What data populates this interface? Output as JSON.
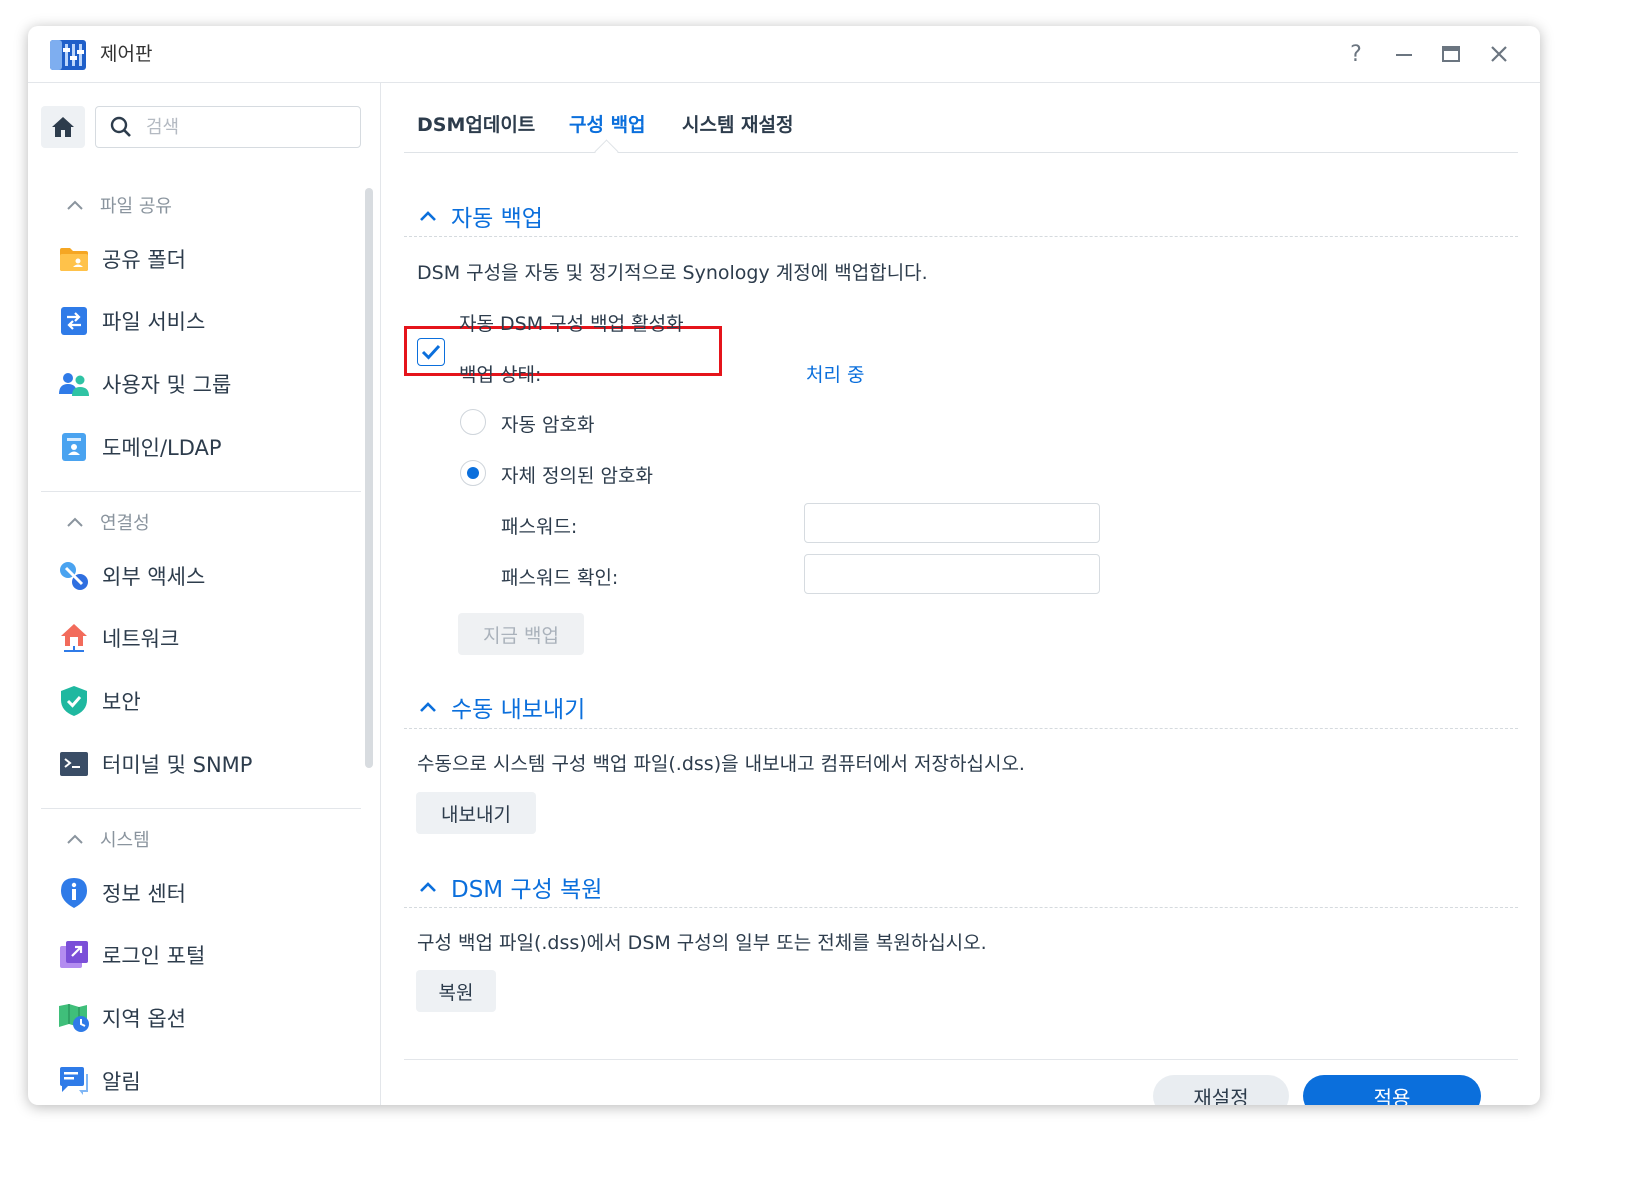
{
  "window": {
    "title": "제어판",
    "controls": {
      "help": "?",
      "minimize": "minimize",
      "maximize": "maximize",
      "close": "close"
    }
  },
  "sidebar": {
    "search": {
      "placeholder": "검색",
      "value": ""
    },
    "groups": [
      {
        "label": "파일 공유",
        "items": [
          {
            "label": "공유 폴더",
            "icon": "shared-folder-icon"
          },
          {
            "label": "파일 서비스",
            "icon": "file-services-icon"
          },
          {
            "label": "사용자 및 그룹",
            "icon": "users-groups-icon"
          },
          {
            "label": "도메인/LDAP",
            "icon": "domain-ldap-icon"
          }
        ]
      },
      {
        "label": "연결성",
        "items": [
          {
            "label": "외부 액세스",
            "icon": "external-access-icon"
          },
          {
            "label": "네트워크",
            "icon": "network-icon"
          },
          {
            "label": "보안",
            "icon": "security-shield-icon"
          },
          {
            "label": "터미널 및 SNMP",
            "icon": "terminal-icon"
          }
        ]
      },
      {
        "label": "시스템",
        "items": [
          {
            "label": "정보 센터",
            "icon": "info-center-icon"
          },
          {
            "label": "로그인 포털",
            "icon": "login-portal-icon"
          },
          {
            "label": "지역 옵션",
            "icon": "regional-options-icon"
          },
          {
            "label": "알림",
            "icon": "notification-icon"
          }
        ]
      }
    ]
  },
  "tabs": [
    {
      "label": "DSM업데이트",
      "active": false
    },
    {
      "label": "구성 백업",
      "active": true
    },
    {
      "label": "시스템 재설정",
      "active": false
    }
  ],
  "auto_backup": {
    "header": "자동 백업",
    "description": "DSM 구성을 자동 및 정기적으로 Synology 계정에 백업합니다.",
    "enable_label": "자동 DSM 구성 백업 활성화",
    "enabled": true,
    "status_label": "백업 상태:",
    "status_value": "처리 중",
    "radio_auto": "자동 암호화",
    "radio_custom": "자체 정의된 암호화",
    "password_label": "패스워드:",
    "password_confirm_label": "패스워드 확인:",
    "backup_now": "지금 백업"
  },
  "manual_export": {
    "header": "수동 내보내기",
    "description": "수동으로 시스템 구성 백업 파일(.dss)을 내보내고 컴퓨터에서 저장하십시오.",
    "button": "내보내기"
  },
  "restore": {
    "header": "DSM 구성 복원",
    "description": "구성 백업 파일(.dss)에서 DSM 구성의 일부 또는 전체를 복원하십시오.",
    "button": "복원"
  },
  "footer": {
    "reset": "재설정",
    "apply": "적용"
  },
  "colors": {
    "accent": "#0b6fdc",
    "highlight": "#e5141b"
  }
}
